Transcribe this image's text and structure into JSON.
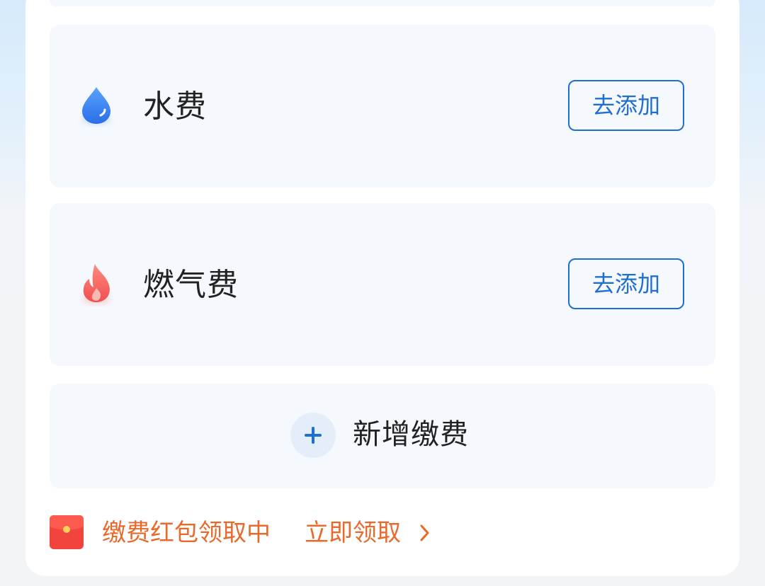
{
  "bills": {
    "water": {
      "label": "水费",
      "button_label": "去添加",
      "icon": "water-drop-icon",
      "icon_color": "#3b82f0"
    },
    "gas": {
      "label": "燃气费",
      "button_label": "去添加",
      "icon": "flame-icon",
      "icon_color": "#f25a5a"
    }
  },
  "new_bill": {
    "label": "新增缴费",
    "icon": "plus-icon"
  },
  "promo": {
    "text": "缴费红包领取中",
    "link_label": "立即领取",
    "icon": "red-envelope-icon",
    "chevron": "chevron-right-icon"
  },
  "colors": {
    "accent": "#1f6fd0",
    "promo": "#e76a2c",
    "card_background": "#f5f8fd"
  }
}
